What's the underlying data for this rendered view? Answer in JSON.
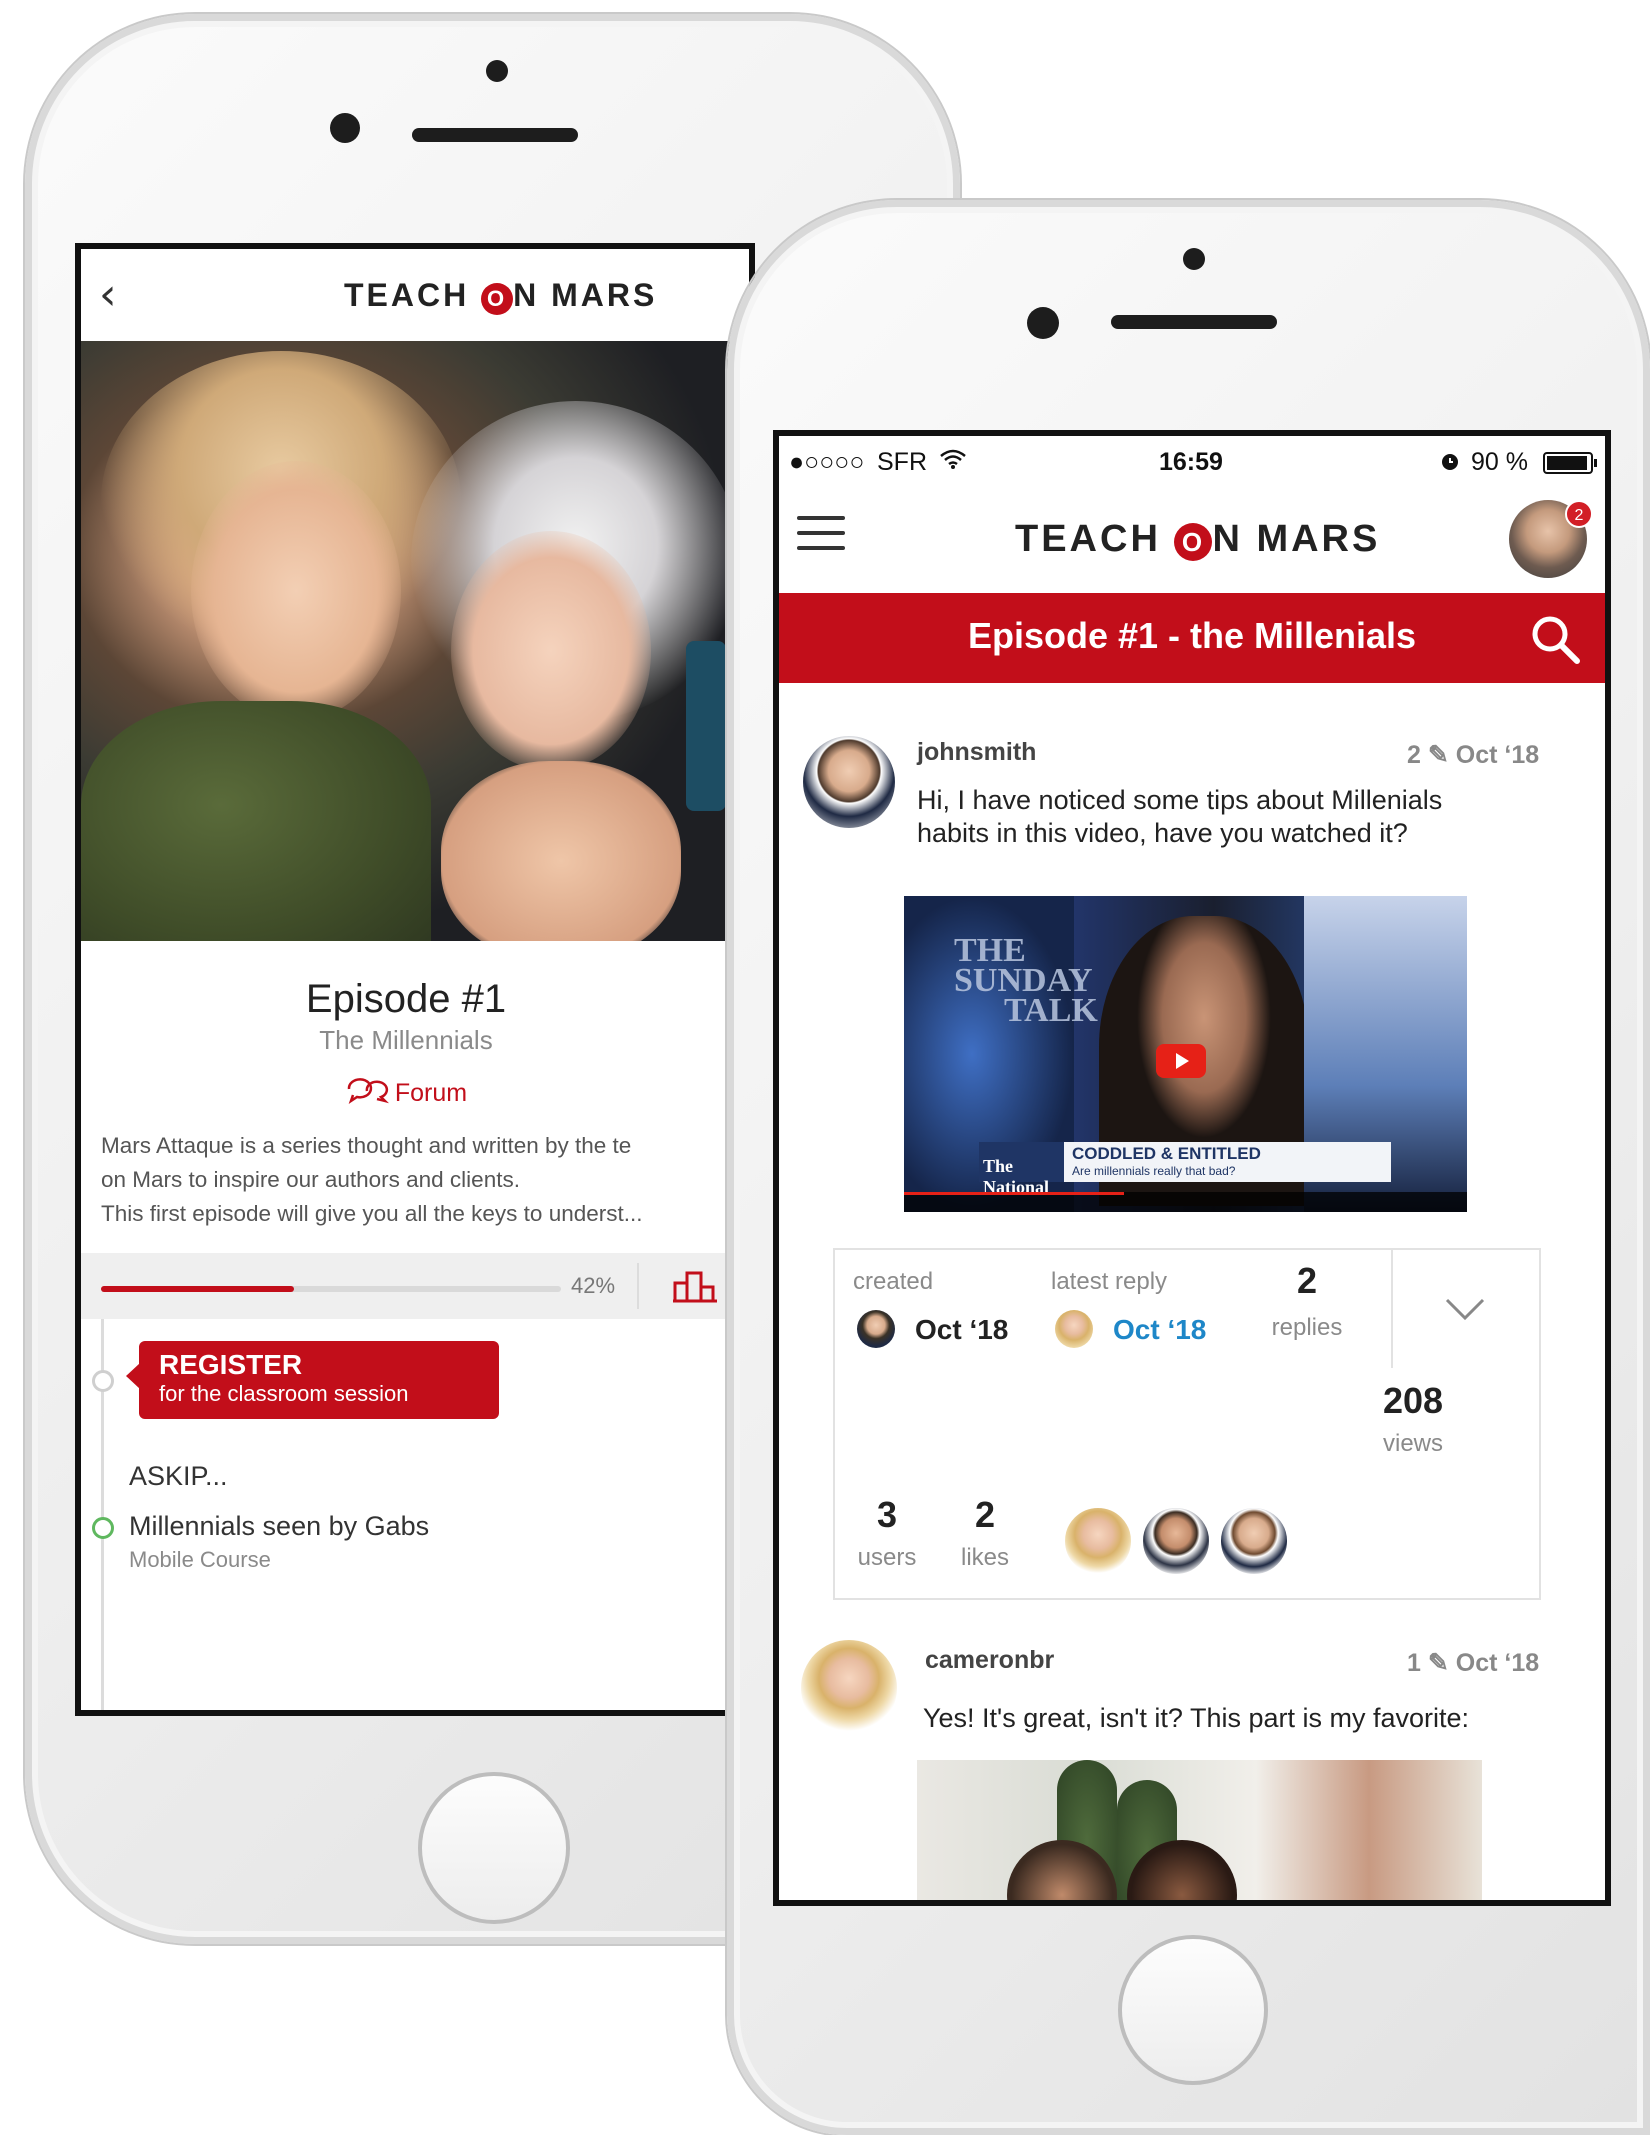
{
  "back_phone": {
    "brand_left": "TEACH",
    "brand_o": "O",
    "brand_right": "N MARS",
    "back_glyph": "‹",
    "episode_title": "Episode #1",
    "episode_subtitle": "The Millennials",
    "forum_label": "Forum",
    "forum_icon": "chat-bubbles-icon",
    "description": [
      "Mars Attaque  is a series thought and written by the te",
      "on Mars to inspire our authors and clients.",
      "This first episode will give you all the keys to underst..."
    ],
    "progress": {
      "percent": 42,
      "label": "42%"
    },
    "stats_icon": "bar-chart-icon",
    "register_title": "REGISTER",
    "register_subtitle": "for the classroom session",
    "askip_label": "ASKIP...",
    "item_title": "Millennials seen by Gabs",
    "item_subtitle": "Mobile Course"
  },
  "front_phone": {
    "status": {
      "signal": "●○○○○",
      "carrier": "SFR",
      "wifi": "wifi-icon",
      "time": "16:59",
      "alarm": "alarm-icon",
      "battery": "90 %"
    },
    "brand_left": "TEACH",
    "brand_o": "O",
    "brand_right": "N MARS",
    "menu_icon": "hamburger-icon",
    "notification_count": "2",
    "page_title": "Episode #1 - the Millenials",
    "search_icon": "search-icon",
    "post1": {
      "username": "johnsmith",
      "edit_count": "2",
      "edit_icon": "pencil-icon",
      "date": "Oct ‘18",
      "text_line1": "Hi, I have noticed some tips about Millenials",
      "text_line2": "habits in this video, have you watched it?",
      "video": {
        "show_title_1": "THE",
        "show_title_2": "SUNDAY",
        "show_title_3": "TALK",
        "network": "The National",
        "headline": "CODDLED & ENTITLED",
        "subheadline": "Are millennials really that bad?"
      }
    },
    "stats": {
      "created_label": "created",
      "created_date": "Oct ‘18",
      "latest_label": "latest reply",
      "latest_date": "Oct ‘18",
      "replies_count": "2",
      "replies_label": "replies",
      "views_count": "208",
      "views_label": "views",
      "users_count": "3",
      "users_label": "users",
      "likes_count": "2",
      "likes_label": "likes",
      "expand_icon": "chevron-down-icon"
    },
    "post2": {
      "username": "cameronbr",
      "edit_count": "1",
      "edit_icon": "pencil-icon",
      "date": "Oct ‘18",
      "text": "Yes! It's great, isn't it? This part is my favorite:"
    },
    "colors": {
      "brand_red": "#c20e1a",
      "link_blue": "#1e87c8"
    }
  }
}
